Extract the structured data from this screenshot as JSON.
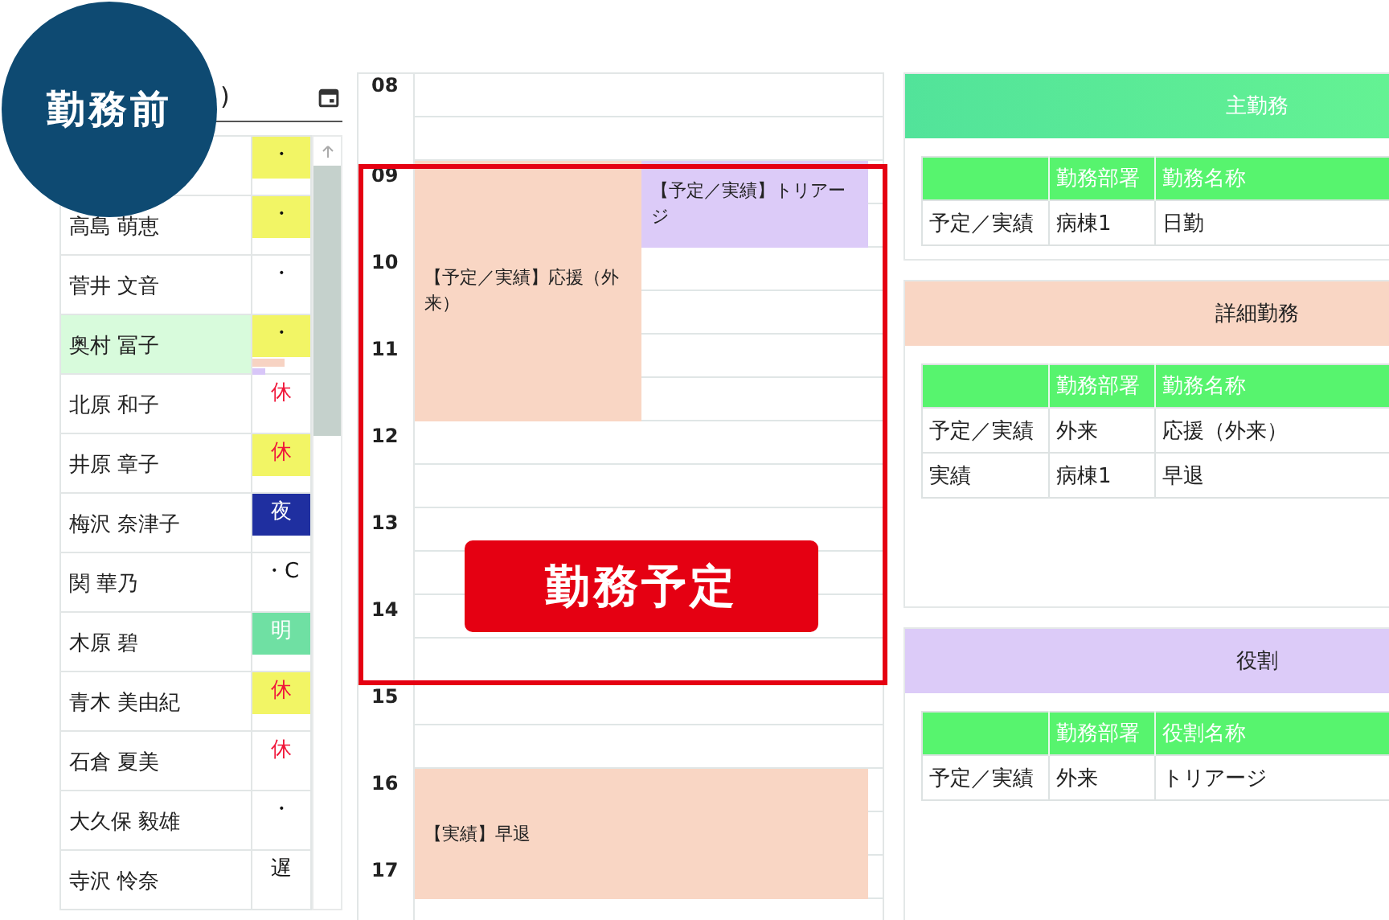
{
  "badge": {
    "label": "勤務前"
  },
  "staff_panel": {
    "header": ")",
    "rows": [
      {
        "status": "・",
        "kind": "day",
        "selected": false
      },
      {
        "name": "高島 萌恵",
        "status": "・",
        "kind": "day",
        "selected": false
      },
      {
        "name": "菅井 文音",
        "status": "・",
        "kind": "plain",
        "selected": false
      },
      {
        "name": "奥村 冨子",
        "status": "・",
        "kind": "day",
        "selected": true,
        "marks": [
          {
            "color": "#f7d3c3"
          },
          {
            "color": "#d8c6f8"
          }
        ]
      },
      {
        "name": "北原 和子",
        "status": "休",
        "kind": "rest",
        "selected": false
      },
      {
        "name": "井原 章子",
        "status": "休",
        "kind": "rest_day",
        "selected": false
      },
      {
        "name": "梅沢 奈津子",
        "status": "夜",
        "kind": "night",
        "selected": false
      },
      {
        "name": "関 華乃",
        "status": "・C",
        "kind": "plain",
        "selected": false
      },
      {
        "name": "木原 碧",
        "status": "明",
        "kind": "after_night",
        "selected": false
      },
      {
        "name": "青木 美由紀",
        "status": "休",
        "kind": "rest_day",
        "selected": false
      },
      {
        "name": "石倉 夏美",
        "status": "休",
        "kind": "rest",
        "selected": false
      },
      {
        "name": "大久保 毅雄",
        "status": "・",
        "kind": "plain",
        "selected": false
      },
      {
        "name": "寺沢 怜奈",
        "status": "遅",
        "kind": "plain",
        "selected": false
      }
    ]
  },
  "timeline": {
    "hours": [
      "08",
      "09",
      "10",
      "11",
      "12",
      "13",
      "14",
      "15",
      "16",
      "17"
    ],
    "events": [
      {
        "text": "【予定／実績】応援（外来）",
        "color": "#f9d6c4"
      },
      {
        "text": "【予定／実績】トリアージ",
        "color": "#dccbf8"
      },
      {
        "text": "【実績】早退",
        "color": "#f9d6c4"
      }
    ],
    "highlight": {
      "label": "勤務予定"
    }
  },
  "panels": [
    {
      "title": "主勤務",
      "kind": "main",
      "columns": [
        "",
        "勤務部署",
        "勤務名称"
      ],
      "rows": [
        [
          "予定／実績",
          "病棟1",
          "日勤"
        ]
      ]
    },
    {
      "title": "詳細勤務",
      "kind": "detail",
      "columns": [
        "",
        "勤務部署",
        "勤務名称"
      ],
      "rows": [
        [
          "予定／実績",
          "外来",
          "応援（外来）"
        ],
        [
          "実績",
          "病棟1",
          "早退"
        ]
      ]
    },
    {
      "title": "役割",
      "kind": "role",
      "columns": [
        "",
        "勤務部署",
        "役割名称"
      ],
      "rows": [
        [
          "予定／実績",
          "外来",
          "トリアージ"
        ]
      ]
    }
  ]
}
